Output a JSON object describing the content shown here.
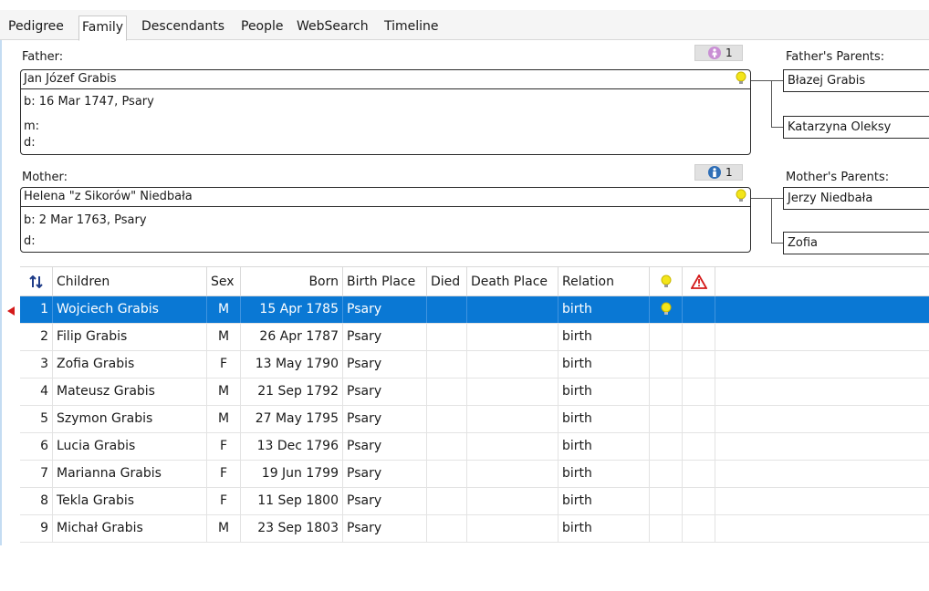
{
  "tabs": [
    "Pedigree",
    "Family",
    "Descendants",
    "People",
    "WebSearch",
    "Timeline"
  ],
  "active_tab": "Family",
  "father": {
    "label": "Father:",
    "name": "Jan Józef Grabis",
    "facts": [
      "b: 16 Mar 1747, Psary",
      "m:",
      "d:"
    ],
    "badge_count": "1"
  },
  "mother": {
    "label": "Mother:",
    "name": "Helena \"z Sikorów\" Niedbała",
    "facts": [
      "b: 2 Mar 1763, Psary",
      "d:"
    ],
    "badge_count": "1"
  },
  "fathers_parents": {
    "label": "Father's Parents:",
    "father": "Błazej Grabis",
    "mother": "Katarzyna Oleksy"
  },
  "mothers_parents": {
    "label": "Mother's Parents:",
    "father": "Jerzy Niedbała",
    "mother": "Zofia"
  },
  "children_table": {
    "columns": [
      "Children",
      "Sex",
      "Born",
      "Birth Place",
      "Died",
      "Death Place",
      "Relation"
    ],
    "sort_icon": "sort-updown-icon",
    "rows": [
      {
        "num": "1",
        "name": "Wojciech Grabis",
        "sex": "M",
        "born": "15 Apr 1785",
        "birth_place": "Psary",
        "died": "",
        "death_place": "",
        "relation": "birth",
        "has_bulb": true
      },
      {
        "num": "2",
        "name": "Filip Grabis",
        "sex": "M",
        "born": "26 Apr 1787",
        "birth_place": "Psary",
        "died": "",
        "death_place": "",
        "relation": "birth",
        "has_bulb": false
      },
      {
        "num": "3",
        "name": "Zofia Grabis",
        "sex": "F",
        "born": "13 May 1790",
        "birth_place": "Psary",
        "died": "",
        "death_place": "",
        "relation": "birth",
        "has_bulb": false
      },
      {
        "num": "4",
        "name": "Mateusz Grabis",
        "sex": "M",
        "born": "21 Sep 1792",
        "birth_place": "Psary",
        "died": "",
        "death_place": "",
        "relation": "birth",
        "has_bulb": false
      },
      {
        "num": "5",
        "name": "Szymon Grabis",
        "sex": "M",
        "born": "27 May 1795",
        "birth_place": "Psary",
        "died": "",
        "death_place": "",
        "relation": "birth",
        "has_bulb": false
      },
      {
        "num": "6",
        "name": "Lucia Grabis",
        "sex": "F",
        "born": "13 Dec 1796",
        "birth_place": "Psary",
        "died": "",
        "death_place": "",
        "relation": "birth",
        "has_bulb": false
      },
      {
        "num": "7",
        "name": "Marianna Grabis",
        "sex": "F",
        "born": "19 Jun 1799",
        "birth_place": "Psary",
        "died": "",
        "death_place": "",
        "relation": "birth",
        "has_bulb": false
      },
      {
        "num": "8",
        "name": "Tekla Grabis",
        "sex": "F",
        "born": "11 Sep 1800",
        "birth_place": "Psary",
        "died": "",
        "death_place": "",
        "relation": "birth",
        "has_bulb": false
      },
      {
        "num": "9",
        "name": "Michał Grabis",
        "sex": "M",
        "born": "23 Sep 1803",
        "birth_place": "Psary",
        "died": "",
        "death_place": "",
        "relation": "birth",
        "has_bulb": false
      }
    ],
    "selected_row": 0
  },
  "colors": {
    "selection": "#0a78d4",
    "female_badge": "#c98fd4",
    "male_badge": "#2f6fb7",
    "bulb": "#f3e51a",
    "warning": "#d41a1a"
  }
}
